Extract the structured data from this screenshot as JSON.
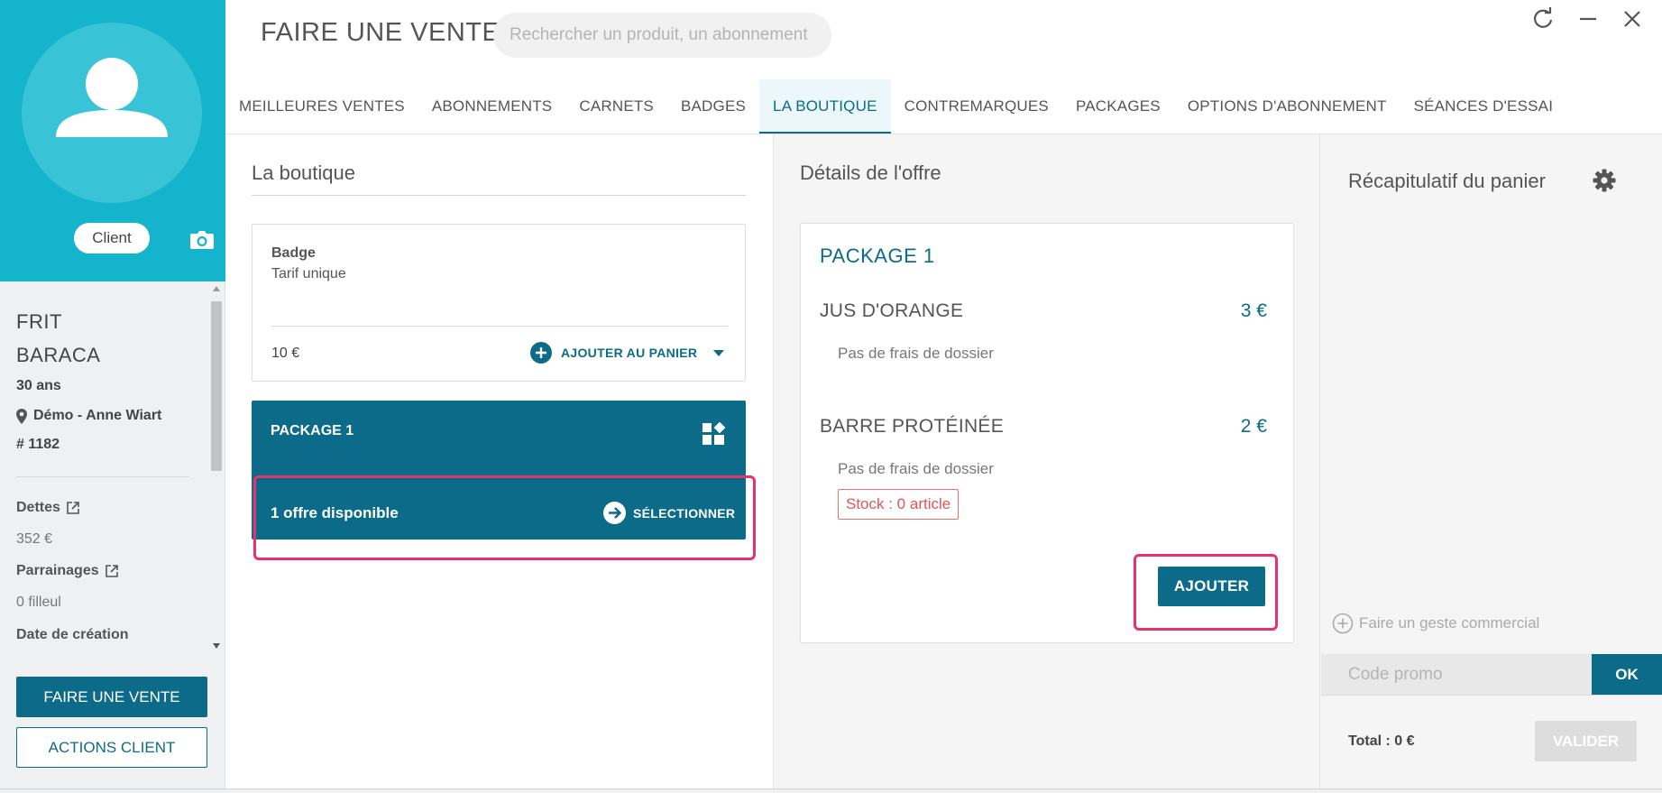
{
  "client": {
    "badge": "Client",
    "first_name": "FRIT",
    "last_name": "BARACA",
    "age": "30 ans",
    "location": "Démo - Anne Wiart",
    "id": "# 1182",
    "debts_label": "Dettes",
    "debts_value": "352 €",
    "referrals_label": "Parrainages",
    "referrals_value": "0 filleul",
    "creation_label": "Date de création"
  },
  "left_buttons": {
    "sale": "FAIRE UNE VENTE",
    "actions": "ACTIONS CLIENT"
  },
  "header": {
    "title": "FAIRE UNE VENTE",
    "search_placeholder": "Rechercher un produit, un abonnement"
  },
  "tabs": [
    {
      "label": "MEILLEURES VENTES"
    },
    {
      "label": "ABONNEMENTS"
    },
    {
      "label": "CARNETS"
    },
    {
      "label": "BADGES"
    },
    {
      "label": "LA BOUTIQUE"
    },
    {
      "label": "CONTREMARQUES"
    },
    {
      "label": "PACKAGES"
    },
    {
      "label": "OPTIONS D'ABONNEMENT"
    },
    {
      "label": "SÉANCES D'ESSAI"
    }
  ],
  "shop": {
    "title": "La boutique",
    "badge_card": {
      "title": "Badge",
      "subtitle": "Tarif unique",
      "price": "10 €",
      "add_label": "AJOUTER AU PANIER"
    },
    "package_card": {
      "title": "PACKAGE 1",
      "offers": "1 offre disponible",
      "select_label": "SÉLECTIONNER"
    }
  },
  "details": {
    "title": "Détails de l'offre",
    "package": "PACKAGE 1",
    "items": [
      {
        "name": "JUS D'ORANGE",
        "price": "3 €",
        "fee": "Pas de frais de dossier"
      },
      {
        "name": "BARRE PROTÉINÉE",
        "price": "2 €",
        "fee": "Pas de frais de dossier"
      }
    ],
    "stock": "Stock : 0 article",
    "add_button": "AJOUTER"
  },
  "cart": {
    "title": "Récapitulatif du panier",
    "geste": "Faire un geste commercial",
    "promo_placeholder": "Code promo",
    "ok": "OK",
    "total": "Total : 0 €",
    "validate": "VALIDER"
  },
  "colors": {
    "primary": "#0d6b8a",
    "header_cyan": "#13b4cc",
    "highlight": "#e5336b",
    "stock_red": "#e05555"
  }
}
